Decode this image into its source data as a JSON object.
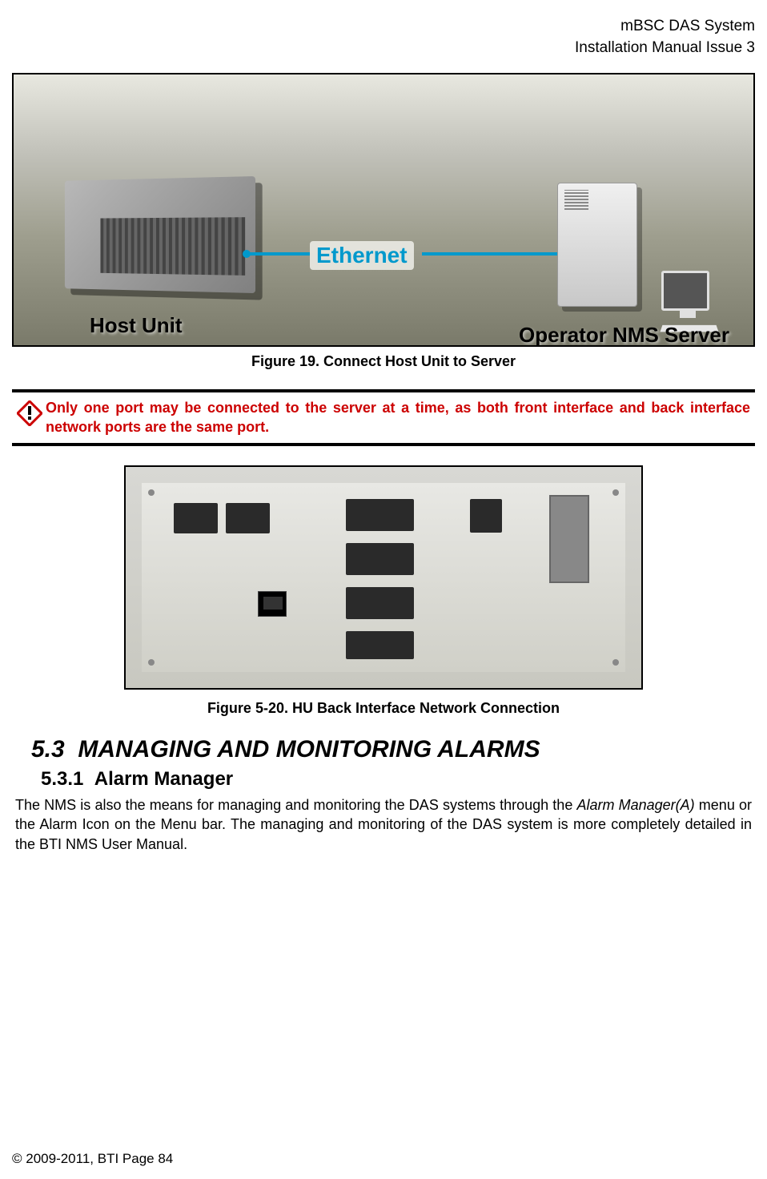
{
  "header": {
    "line1": "mBSC DAS System",
    "line2": "Installation Manual Issue 3"
  },
  "figure1": {
    "host_label": "Host Unit",
    "ethernet_label": "Ethernet",
    "nms_label": "Operator NMS Server",
    "caption": "Figure 19. Connect Host Unit to Server"
  },
  "warning": {
    "text": "Only one port may be connected to the server at a time, as both front interface and back interface network ports are the same port."
  },
  "figure2": {
    "caption": "Figure 5-20. HU Back Interface Network Connection"
  },
  "section": {
    "number": "5.3",
    "title": "MANAGING AND MONITORING ALARMS"
  },
  "subsection": {
    "number": "5.3.1",
    "title": "Alarm Manager"
  },
  "body": {
    "p1_part1": "The NMS is also the means for managing and monitoring the DAS systems through the ",
    "p1_italic": "Alarm Manager(A)",
    "p1_part2": " menu or the Alarm Icon on the Menu bar. The managing and monitoring of the DAS system is more completely detailed in the BTI NMS User Manual."
  },
  "footer": {
    "text": "© 2009-2011, BTI Page 84"
  }
}
